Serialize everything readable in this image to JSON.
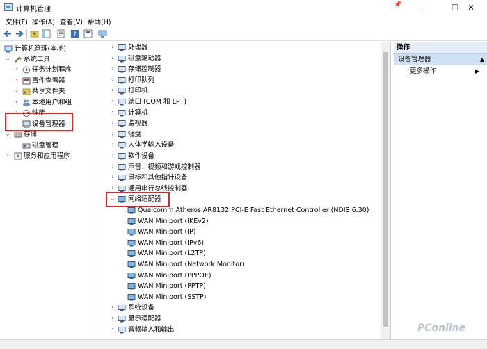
{
  "window": {
    "title": "计算机管理",
    "minimize": "—",
    "maximize": "☐",
    "close": "✕",
    "pin": "📌"
  },
  "menu": [
    "文件(F)",
    "操作(A)",
    "查看(V)",
    "帮助(H)"
  ],
  "left_tree": {
    "root": "计算机管理(本地)",
    "system_tools": "系统工具",
    "task_scheduler": "任务计划程序",
    "event_viewer": "事件查看器",
    "shared_folders": "共享文件夹",
    "local_users": "本地用户和组",
    "performance": "性能",
    "device_manager": "设备管理器",
    "storage": "存储",
    "disk_management": "磁盘管理",
    "services_apps": "服务和应用程序"
  },
  "devices": {
    "before": [
      "处理器",
      "磁盘驱动器",
      "存储控制器",
      "打印队列",
      "打印机",
      "端口 (COM 和 LPT)",
      "计算机",
      "监视器",
      "键盘",
      "人体学输入设备",
      "软件设备",
      "声音、视频和游戏控制器",
      "鼠标和其他指针设备",
      "通用串行总线控制器"
    ],
    "network_adapters": "网络适配器",
    "adapters": [
      "Qualcomm Atheros AR8132 PCI-E Fast Ethernet Controller (NDIS 6.30)",
      "WAN Miniport (IKEv2)",
      "WAN Miniport (IP)",
      "WAN Miniport (IPv6)",
      "WAN Miniport (L2TP)",
      "WAN Miniport (Network Monitor)",
      "WAN Miniport (PPPOE)",
      "WAN Miniport (PPTP)",
      "WAN Miniport (SSTP)"
    ],
    "after": [
      "系统设备",
      "显示适配器",
      "音频输入和输出"
    ]
  },
  "actions": {
    "header": "操作",
    "section": "设备管理器",
    "more": "更多操作"
  },
  "watermark": "PConline"
}
